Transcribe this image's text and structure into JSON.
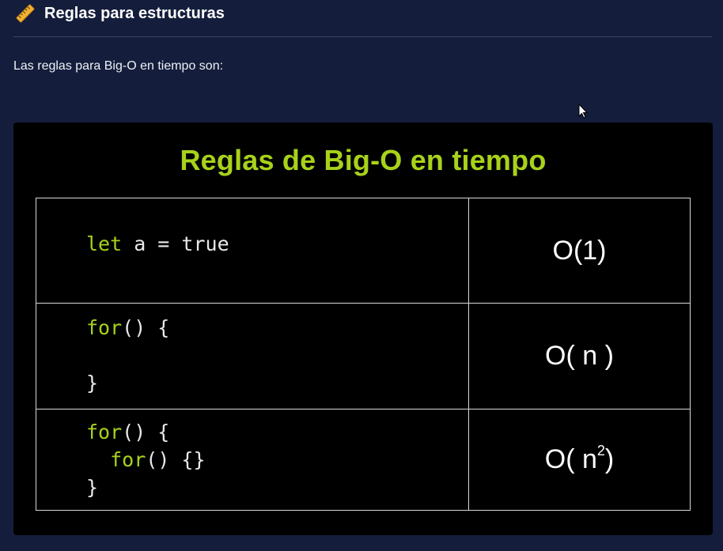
{
  "section": {
    "icon": "ruler-icon",
    "title": "Reglas para estructuras"
  },
  "intro_text": "Las reglas para Big-O en tiempo son:",
  "figure": {
    "title": "Reglas de Big-O en tiempo",
    "rows": [
      {
        "code_lines": [
          {
            "keyword": "let",
            "rest": " a = true"
          }
        ],
        "complexity": "O(1)"
      },
      {
        "code_lines": [
          {
            "keyword": "for",
            "rest": "() {"
          },
          {
            "keyword": "",
            "rest": ""
          },
          {
            "keyword": "",
            "rest": "}"
          }
        ],
        "complexity": "O( n )"
      },
      {
        "code_lines": [
          {
            "keyword": "for",
            "rest": "() {"
          },
          {
            "indent": "  ",
            "keyword": "for",
            "rest": "() {}"
          },
          {
            "keyword": "",
            "rest": "}"
          }
        ],
        "complexity_base": "O( n",
        "complexity_exp": "2",
        "complexity_close": ")"
      }
    ],
    "colors": {
      "keyword": "#a8d21a",
      "title": "#a8d21a",
      "background": "#000000",
      "page_background": "#141e3c"
    }
  }
}
